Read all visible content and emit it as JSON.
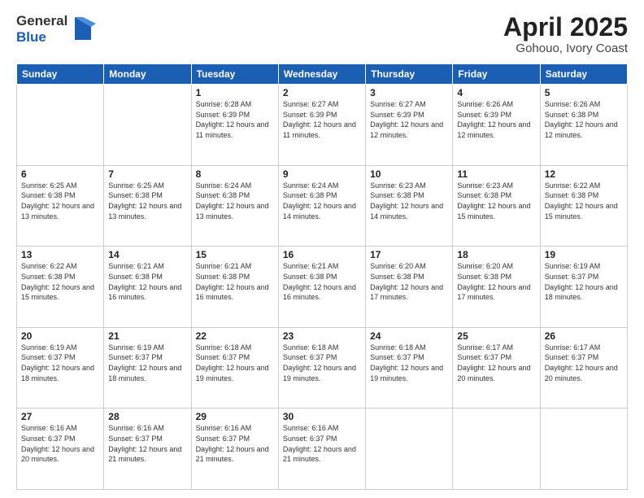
{
  "header": {
    "logo_line1": "General",
    "logo_line2": "Blue",
    "month_title": "April 2025",
    "location": "Gohouo, Ivory Coast"
  },
  "weekdays": [
    "Sunday",
    "Monday",
    "Tuesday",
    "Wednesday",
    "Thursday",
    "Friday",
    "Saturday"
  ],
  "weeks": [
    [
      {
        "day": "",
        "info": ""
      },
      {
        "day": "",
        "info": ""
      },
      {
        "day": "1",
        "info": "Sunrise: 6:28 AM\nSunset: 6:39 PM\nDaylight: 12 hours and 11 minutes."
      },
      {
        "day": "2",
        "info": "Sunrise: 6:27 AM\nSunset: 6:39 PM\nDaylight: 12 hours and 11 minutes."
      },
      {
        "day": "3",
        "info": "Sunrise: 6:27 AM\nSunset: 6:39 PM\nDaylight: 12 hours and 12 minutes."
      },
      {
        "day": "4",
        "info": "Sunrise: 6:26 AM\nSunset: 6:39 PM\nDaylight: 12 hours and 12 minutes."
      },
      {
        "day": "5",
        "info": "Sunrise: 6:26 AM\nSunset: 6:38 PM\nDaylight: 12 hours and 12 minutes."
      }
    ],
    [
      {
        "day": "6",
        "info": "Sunrise: 6:25 AM\nSunset: 6:38 PM\nDaylight: 12 hours and 13 minutes."
      },
      {
        "day": "7",
        "info": "Sunrise: 6:25 AM\nSunset: 6:38 PM\nDaylight: 12 hours and 13 minutes."
      },
      {
        "day": "8",
        "info": "Sunrise: 6:24 AM\nSunset: 6:38 PM\nDaylight: 12 hours and 13 minutes."
      },
      {
        "day": "9",
        "info": "Sunrise: 6:24 AM\nSunset: 6:38 PM\nDaylight: 12 hours and 14 minutes."
      },
      {
        "day": "10",
        "info": "Sunrise: 6:23 AM\nSunset: 6:38 PM\nDaylight: 12 hours and 14 minutes."
      },
      {
        "day": "11",
        "info": "Sunrise: 6:23 AM\nSunset: 6:38 PM\nDaylight: 12 hours and 15 minutes."
      },
      {
        "day": "12",
        "info": "Sunrise: 6:22 AM\nSunset: 6:38 PM\nDaylight: 12 hours and 15 minutes."
      }
    ],
    [
      {
        "day": "13",
        "info": "Sunrise: 6:22 AM\nSunset: 6:38 PM\nDaylight: 12 hours and 15 minutes."
      },
      {
        "day": "14",
        "info": "Sunrise: 6:21 AM\nSunset: 6:38 PM\nDaylight: 12 hours and 16 minutes."
      },
      {
        "day": "15",
        "info": "Sunrise: 6:21 AM\nSunset: 6:38 PM\nDaylight: 12 hours and 16 minutes."
      },
      {
        "day": "16",
        "info": "Sunrise: 6:21 AM\nSunset: 6:38 PM\nDaylight: 12 hours and 16 minutes."
      },
      {
        "day": "17",
        "info": "Sunrise: 6:20 AM\nSunset: 6:38 PM\nDaylight: 12 hours and 17 minutes."
      },
      {
        "day": "18",
        "info": "Sunrise: 6:20 AM\nSunset: 6:38 PM\nDaylight: 12 hours and 17 minutes."
      },
      {
        "day": "19",
        "info": "Sunrise: 6:19 AM\nSunset: 6:37 PM\nDaylight: 12 hours and 18 minutes."
      }
    ],
    [
      {
        "day": "20",
        "info": "Sunrise: 6:19 AM\nSunset: 6:37 PM\nDaylight: 12 hours and 18 minutes."
      },
      {
        "day": "21",
        "info": "Sunrise: 6:19 AM\nSunset: 6:37 PM\nDaylight: 12 hours and 18 minutes."
      },
      {
        "day": "22",
        "info": "Sunrise: 6:18 AM\nSunset: 6:37 PM\nDaylight: 12 hours and 19 minutes."
      },
      {
        "day": "23",
        "info": "Sunrise: 6:18 AM\nSunset: 6:37 PM\nDaylight: 12 hours and 19 minutes."
      },
      {
        "day": "24",
        "info": "Sunrise: 6:18 AM\nSunset: 6:37 PM\nDaylight: 12 hours and 19 minutes."
      },
      {
        "day": "25",
        "info": "Sunrise: 6:17 AM\nSunset: 6:37 PM\nDaylight: 12 hours and 20 minutes."
      },
      {
        "day": "26",
        "info": "Sunrise: 6:17 AM\nSunset: 6:37 PM\nDaylight: 12 hours and 20 minutes."
      }
    ],
    [
      {
        "day": "27",
        "info": "Sunrise: 6:16 AM\nSunset: 6:37 PM\nDaylight: 12 hours and 20 minutes."
      },
      {
        "day": "28",
        "info": "Sunrise: 6:16 AM\nSunset: 6:37 PM\nDaylight: 12 hours and 21 minutes."
      },
      {
        "day": "29",
        "info": "Sunrise: 6:16 AM\nSunset: 6:37 PM\nDaylight: 12 hours and 21 minutes."
      },
      {
        "day": "30",
        "info": "Sunrise: 6:16 AM\nSunset: 6:37 PM\nDaylight: 12 hours and 21 minutes."
      },
      {
        "day": "",
        "info": ""
      },
      {
        "day": "",
        "info": ""
      },
      {
        "day": "",
        "info": ""
      }
    ]
  ]
}
